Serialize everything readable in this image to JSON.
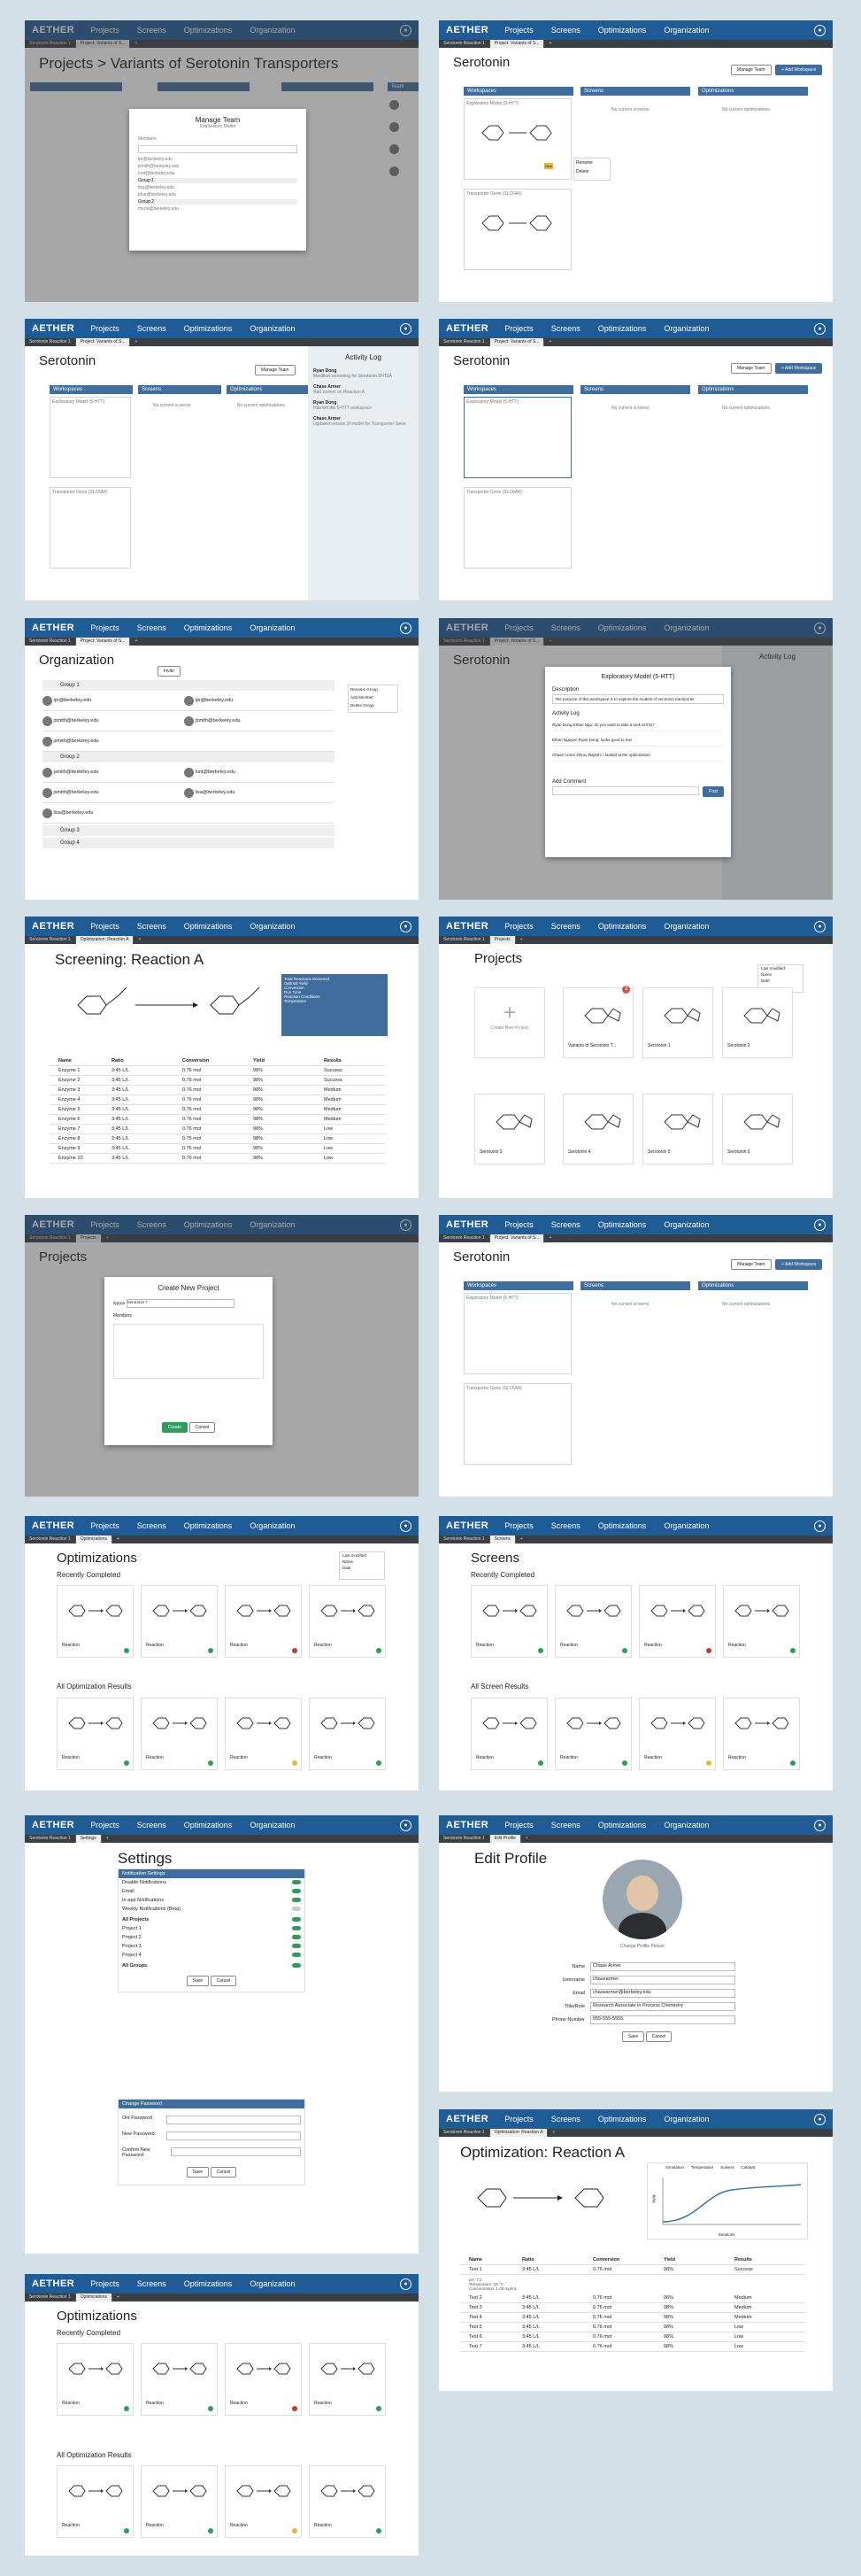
{
  "nav": {
    "logo": "AETHER",
    "projects": "Projects",
    "screens": "Screens",
    "optimizations": "Optimizations",
    "organization": "Organization"
  },
  "tabs": {
    "t1": "Serotonin Reaction 1",
    "t2": "Project: Variants of S...",
    "t3": "Optimization: Reaction A",
    "plus": "+"
  },
  "p1": {
    "title": "Projects > Variants of Serotonin Transporters",
    "modal_title": "Manage Team",
    "modal_sub": "Exploratory Model",
    "members_label": "Members",
    "group1": "Group 1",
    "group2": "Group 2",
    "emails": [
      "lpr@berkeley.edu",
      "jsmith@berkeley.edu",
      "lunt@berkeley.edu",
      "lisa@berkeley.edu",
      "jdoe@berkeley.edu",
      "meral@berkeley.edu"
    ],
    "team_label": "Team"
  },
  "serotonin": {
    "title": "Serotonin",
    "manage_team": "Manage Team",
    "new_workspace": "+ Add Workspace",
    "workspaces": "Workspaces",
    "screens": "Screens",
    "optimizations": "Optimizations",
    "no_screens": "No current screens",
    "no_opts": "No current optimizations",
    "ws1": "Exploratory Model (5-HTT)",
    "ws2": "Transporter Gene (SLC6A4)",
    "new_label": "New",
    "menu_rename": "Rename",
    "menu_delete": "Delete"
  },
  "activity": {
    "title": "Activity Log",
    "e1_name": "Ryan Dong",
    "e1_text": "Modified screening for Serotonin 5HT2A",
    "e2_name": "Chase Armer",
    "e2_text": "Ran screen on Reaction A",
    "e3_name": "Ryan Dong",
    "e3_text": "Has left the 5-HTT workspace",
    "e4_name": "Chase Armer",
    "e4_text": "Updated version of model for Transporter Gene"
  },
  "org": {
    "title": "Organization",
    "invite": "Invite",
    "g1": "Group 1",
    "g2": "Group 2",
    "g3": "Group 3",
    "g4": "Group 4",
    "a1": "lpr@berkeley.edu",
    "a2": "lpr@berkeley.edu",
    "a3": "jsmith@berkeley.edu",
    "a4": "jsmith@berkeley.edu",
    "a5": "jsmith@berkeley.edu",
    "a6": "jsmith@berkeley.edu",
    "a7": "lunt@berkeley.edu",
    "a8": "jsmith@berkeley.edu",
    "a9": "lisa@berkeley.edu",
    "a10": "lisa@berkeley.edu",
    "a11": "jdoe@berkeley.edu",
    "menu1": "Rename Group",
    "menu2": "Add Member",
    "menu3": "Delete Group"
  },
  "explmodal": {
    "title": "Exploratory Model (5-HTT)",
    "desc_label": "Description",
    "desc": "The purpose of this workspace is to explore the models of serotonin transporter.",
    "log_label": "Activity Log",
    "l1": "Ryan Dong  Ethan Ngo: do you want to take a look at this?",
    "l2": "Ethan Nguyen  Ryan Dong: looks good to me!",
    "l3": "Chase Armer  Dhruv Rajesh: I looked at the optimization",
    "comment_label": "Add Comment",
    "post": "Post"
  },
  "screening": {
    "title": "Screening: Reaction A",
    "stats": [
      "Total Reactions Screened",
      "Optimal Yield",
      "Conversion",
      "Run Time",
      "Reaction Conditions",
      "Temperature"
    ],
    "headers": [
      "Name",
      "Ratio",
      "Conversion",
      "Yield",
      "Results"
    ],
    "rows": [
      [
        "Enzyme 1",
        "3:45 L/L",
        "0.76 mol",
        "98%",
        "Success"
      ],
      [
        "Enzyme 2",
        "3:45 L/L",
        "0.76 mol",
        "98%",
        "Success"
      ],
      [
        "Enzyme 3",
        "3:45 L/L",
        "0.76 mol",
        "98%",
        "Medium"
      ],
      [
        "Enzyme 4",
        "3:45 L/L",
        "0.76 mol",
        "98%",
        "Medium"
      ],
      [
        "Enzyme 5",
        "3:45 L/L",
        "0.76 mol",
        "98%",
        "Medium"
      ],
      [
        "Enzyme 6",
        "3:45 L/L",
        "0.76 mol",
        "98%",
        "Medium"
      ],
      [
        "Enzyme 7",
        "3:45 L/L",
        "0.76 mol",
        "98%",
        "Low"
      ],
      [
        "Enzyme 8",
        "3:45 L/L",
        "0.76 mol",
        "98%",
        "Low"
      ],
      [
        "Enzyme 9",
        "3:45 L/L",
        "0.76 mol",
        "98%",
        "Low"
      ],
      [
        "Enzyme 10",
        "3:45 L/L",
        "0.76 mol",
        "98%",
        "Low"
      ]
    ]
  },
  "projects": {
    "title": "Projects",
    "create": "Create New Project",
    "items": [
      "Variants of Serotonin T...",
      "Serotonin 1",
      "Serotonin 2",
      "Serotonin 3",
      "Serotonin 4",
      "Serotonin 5",
      "Serotonin 6"
    ],
    "badge": "3",
    "sort1": "Last modified",
    "sort2": "Name",
    "sort3": "Date"
  },
  "createmodal": {
    "title": "Create New Project",
    "name_label": "Name",
    "name_val": "Serotonin 7",
    "members_label": "Members",
    "create": "Create",
    "cancel": "Cancel"
  },
  "opts": {
    "title": "Optimizations",
    "recent": "Recently Completed",
    "all": "All Optimization Results",
    "reaction": "Reaction",
    "sort1": "Last modified",
    "sort2": "Name",
    "sort3": "Date"
  },
  "screens": {
    "title": "Screens",
    "recent": "Recently Completed",
    "all": "All Screen Results",
    "reaction": "Reaction"
  },
  "settings": {
    "title": "Settings",
    "notif": "Notification Settings",
    "disable": "Disable Notifications",
    "email": "Email",
    "inapp": "In-app Notifications",
    "weekly": "Weekly Notifications (Beta)",
    "all_projects": "All Projects",
    "project1": "Project 1",
    "project2": "Project 2",
    "project3": "Project 3",
    "project4": "Project 4",
    "all_groups": "All Groups",
    "save": "Save",
    "cancel": "Cancel",
    "change_pw": "Change Password",
    "old_pw": "Old Password",
    "new_pw": "New Password",
    "confirm_pw": "Confirm New Password"
  },
  "profile": {
    "title": "Edit Profile",
    "change_photo": "Change Profile Picture",
    "name_label": "Name",
    "name": "Chase Armer",
    "username_label": "Username",
    "username": "chasearmer",
    "email_label": "Email",
    "email": "chasearmer@berkeley.edu",
    "position_label": "Title/Role",
    "position": "Research Associate in Process Chemistry",
    "phone_label": "Phone Number",
    "phone": "555-555-5555",
    "save": "Save",
    "cancel": "Cancel"
  },
  "optreaction": {
    "title": "Optimization: Reaction A",
    "legend": [
      "Simulation",
      "Temperature",
      "Solvent",
      "Catalyst"
    ],
    "ylabel": "Yield",
    "xlabel": "Iterations",
    "headers": [
      "Name",
      "Ratio",
      "Conversion",
      "Yield",
      "Results"
    ],
    "rows": [
      [
        "Test 1",
        "3:45 L/L",
        "0.76 mol",
        "98%",
        "Success"
      ],
      [
        "Test 2",
        "3:45 L/L",
        "0.76 mol",
        "98%",
        "Medium"
      ],
      [
        "Test 3",
        "3:45 L/L",
        "0.76 mol",
        "98%",
        "Medium"
      ],
      [
        "Test 4",
        "3:45 L/L",
        "0.76 mol",
        "98%",
        "Medium"
      ],
      [
        "Test 5",
        "3:45 L/L",
        "0.76 mol",
        "98%",
        "Low"
      ],
      [
        "Test 6",
        "3:45 L/L",
        "0.76 mol",
        "98%",
        "Low"
      ],
      [
        "Test 7",
        "3:45 L/L",
        "0.76 mol",
        "98%",
        "Low"
      ]
    ],
    "details": [
      "pH: 7.0",
      "Temperature: 25 °C",
      "Concentration: 1.00 mg/mL"
    ]
  },
  "colors": {
    "nav": "#1f5b95",
    "accent": "#3f6d9d",
    "bg": "#d3e0e7",
    "success": "#2e9d5b",
    "warn": "#e6b93b",
    "danger": "#c0392b"
  }
}
